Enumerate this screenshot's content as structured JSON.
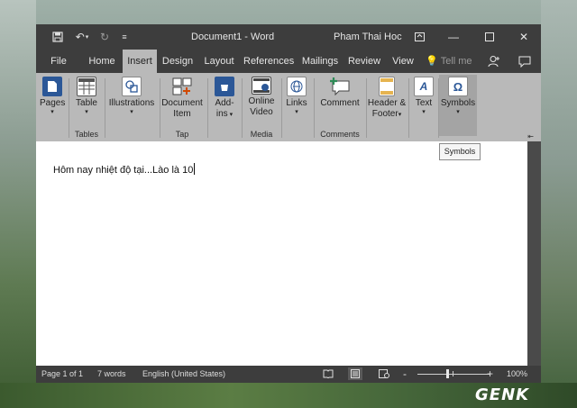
{
  "titlebar": {
    "doc_title": "Document1 - Word",
    "user_name": "Pham Thai Hoc",
    "save_icon": "save-icon",
    "undo_icon": "undo-icon",
    "redo_icon": "redo-icon",
    "customize_icon": "customize-qat-icon"
  },
  "tabs": [
    {
      "label": "File"
    },
    {
      "label": "Home"
    },
    {
      "label": "Insert"
    },
    {
      "label": "Design"
    },
    {
      "label": "Layout"
    },
    {
      "label": "References"
    },
    {
      "label": "Mailings"
    },
    {
      "label": "Review"
    },
    {
      "label": "View"
    }
  ],
  "tell_me": "Tell me",
  "ribbon": {
    "pages": {
      "label": "Pages"
    },
    "table": {
      "label": "Table",
      "group": "Tables"
    },
    "illustrations": {
      "label": "Illustrations"
    },
    "document_item": {
      "line1": "Document",
      "line2": "Item",
      "group": "Tap"
    },
    "addins": {
      "line1": "Add-",
      "line2": "ins"
    },
    "online_video": {
      "line1": "Online",
      "line2": "Video",
      "group": "Media"
    },
    "links": {
      "label": "Links"
    },
    "comment": {
      "label": "Comment",
      "group": "Comments"
    },
    "header_footer": {
      "line1": "Header &",
      "line2": "Footer"
    },
    "text": {
      "label": "Text"
    },
    "symbols": {
      "label": "Symbols"
    }
  },
  "tooltip": "Symbols",
  "document": {
    "text": "Hôm nay nhiệt độ tại...Lào là 10"
  },
  "statusbar": {
    "page": "Page 1 of 1",
    "words": "7 words",
    "language": "English (United States)",
    "zoom_minus": "-",
    "zoom_plus": "+",
    "zoom": "100%"
  },
  "watermark": "GENK",
  "colors": {
    "titlebar": "#3d3d3d",
    "ribbon": "#b9b9b9",
    "accent_blue": "#2b5797"
  }
}
